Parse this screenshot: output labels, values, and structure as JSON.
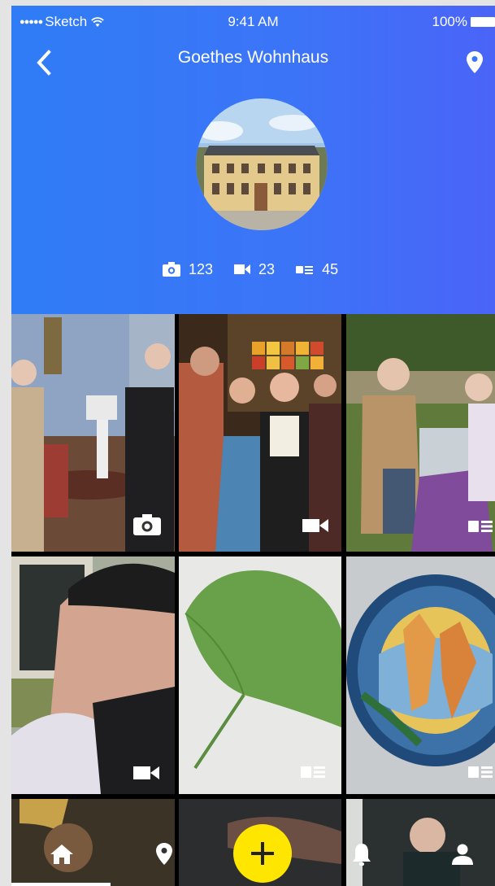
{
  "status_bar": {
    "carrier": "Sketch",
    "time": "9:41 AM",
    "battery": "100%"
  },
  "header": {
    "title": "Goethes Wohnhaus",
    "back_icon": "chevron-left-icon",
    "location_icon": "location-pin-icon"
  },
  "stats": {
    "photos": "123",
    "videos": "23",
    "articles": "45"
  },
  "grid": {
    "tiles": [
      {
        "type": "photo",
        "icon": "camera-icon"
      },
      {
        "type": "video",
        "icon": "video-icon"
      },
      {
        "type": "article",
        "icon": "article-icon"
      },
      {
        "type": "video",
        "icon": "video-icon"
      },
      {
        "type": "article",
        "icon": "article-icon"
      },
      {
        "type": "article",
        "icon": "article-icon"
      }
    ]
  },
  "bottom_nav": {
    "items": [
      "home-icon",
      "location-pin-icon",
      "add-icon",
      "bell-icon",
      "profile-icon"
    ],
    "accent": "#ffe600"
  },
  "colors": {
    "header_start": "#2f7cf6",
    "header_end": "#4a64f8"
  }
}
